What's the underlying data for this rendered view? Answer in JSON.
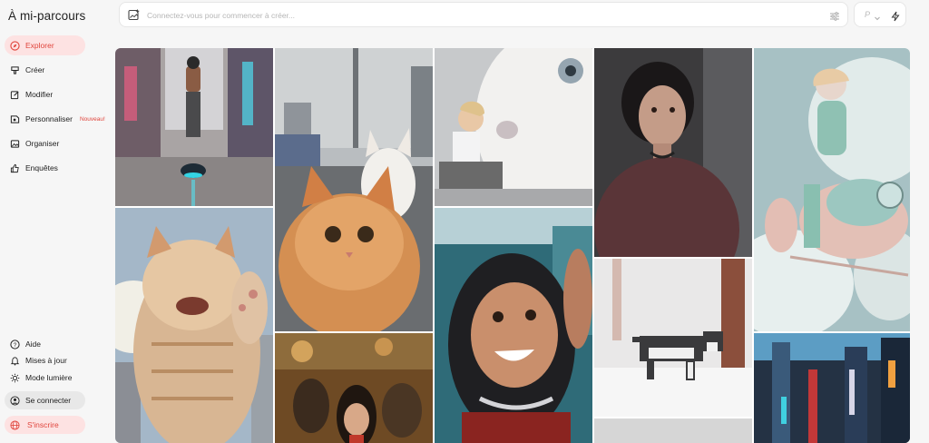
{
  "brand": {
    "title": "À mi-parcours"
  },
  "nav": {
    "explore": "Explorer",
    "create": "Créer",
    "edit": "Modifier",
    "personalize": "Personnaliser",
    "personalize_badge": "Nouveau!",
    "organize": "Organiser",
    "surveys": "Enquêtes"
  },
  "footer_nav": {
    "help": "Aide",
    "updates": "Mises à jour",
    "light_mode": "Mode lumière",
    "sign_in": "Se connecter",
    "sign_up": "S'inscrire"
  },
  "prompt": {
    "placeholder": "Connectez-vous pour commencer à créer..."
  },
  "toolbar": {
    "p_label": "P"
  },
  "gallery": {
    "items": [
      {
        "subject": "cyberpunk street rider"
      },
      {
        "subject": "orange cat selfie in city"
      },
      {
        "subject": "girl hugging giant white cat"
      },
      {
        "subject": "portrait woman in shadow"
      },
      {
        "subject": "pilot on flying vehicle in clouds"
      },
      {
        "subject": "giant tabby cat waving"
      },
      {
        "subject": "smiling woman selfie"
      },
      {
        "subject": "woman in restaurant"
      },
      {
        "subject": "pixel dog in snow"
      },
      {
        "subject": "neon city street"
      },
      {
        "subject": "partial image"
      }
    ]
  },
  "colors": {
    "accent": "#e0453c",
    "accent_bg": "#fde2e2",
    "background": "#f6f6f6"
  }
}
